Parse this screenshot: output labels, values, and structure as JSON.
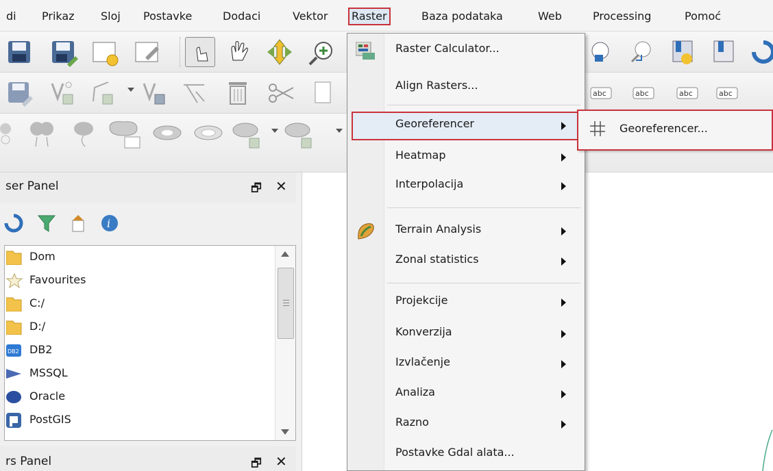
{
  "menubar": {
    "items": [
      "di",
      "Prikaz",
      "Sloj",
      "Postavke",
      "Dodaci",
      "Vektor",
      "Raster",
      "Baza podataka",
      "Web",
      "Processing",
      "Pomoć"
    ]
  },
  "toolbars": {
    "row1_icons": [
      "save-project-icon",
      "save-as-icon",
      "new-print-layout-icon",
      "layout-manager-icon",
      "touch-zoom-icon",
      "pan-map-icon",
      "pan-to-selection-icon",
      "zoom-in-icon"
    ],
    "row2_icons": [
      "save-edits-icon",
      "add-point-icon",
      "add-line-icon",
      "move-feature-icon",
      "node-tool-icon",
      "delete-selected-icon",
      "cut-features-icon",
      "copy-features-icon"
    ],
    "row3_icons": [
      "simplify-feature-icon",
      "add-ring-icon",
      "add-part-icon",
      "fill-ring-icon",
      "delete-ring-icon",
      "delete-part-icon",
      "reshape-icon",
      "offset-curve-icon"
    ],
    "right_icons": [
      "identify-icon",
      "zoom-to-layer-icon",
      "show-bookmarks-icon",
      "new-bookmark-icon",
      "refresh-icon"
    ],
    "label_icons": [
      "label-abc-icon",
      "label-abc-icon",
      "label-abc-icon",
      "label-abc-icon"
    ]
  },
  "browser_panel": {
    "title": "ser Panel",
    "float_glyph": "🗗",
    "close_glyph": "✕",
    "toolbar_icons": [
      "refresh-icon",
      "filter-icon",
      "collapse-all-icon",
      "info-icon"
    ],
    "items": [
      {
        "label": "Dom",
        "icon": "folder-icon"
      },
      {
        "label": "Favourites",
        "icon": "star-icon"
      },
      {
        "label": "C:/",
        "icon": "folder-icon"
      },
      {
        "label": "D:/",
        "icon": "folder-icon"
      },
      {
        "label": "DB2",
        "icon": "db2-icon"
      },
      {
        "label": "MSSQL",
        "icon": "mssql-icon"
      },
      {
        "label": "Oracle",
        "icon": "oracle-icon"
      },
      {
        "label": "PostGIS",
        "icon": "postgis-icon"
      }
    ]
  },
  "layers_panel": {
    "title": "rs Panel",
    "float_glyph": "🗗",
    "close_glyph": "✕"
  },
  "raster_menu": {
    "items": [
      {
        "label": "Raster Calculator...",
        "icon": "raster-calculator-icon",
        "submenu": false
      },
      {
        "label": "Align Rasters...",
        "icon": "",
        "submenu": false
      },
      {
        "label": "Georeferencer",
        "icon": "",
        "submenu": true,
        "highlighted": true
      },
      {
        "label": "Heatmap",
        "icon": "",
        "submenu": true
      },
      {
        "label": "Interpolacija",
        "icon": "",
        "submenu": true
      },
      {
        "label": "Terrain Analysis",
        "icon": "terrain-analysis-icon",
        "submenu": true
      },
      {
        "label": "Zonal statistics",
        "icon": "",
        "submenu": true
      },
      {
        "label": "Projekcije",
        "icon": "",
        "submenu": true
      },
      {
        "label": "Konverzija",
        "icon": "",
        "submenu": true
      },
      {
        "label": "Izvlačenje",
        "icon": "",
        "submenu": true
      },
      {
        "label": "Analiza",
        "icon": "",
        "submenu": true
      },
      {
        "label": "Razno",
        "icon": "",
        "submenu": true
      },
      {
        "label": "Postavke Gdal alata...",
        "icon": "",
        "submenu": false
      }
    ]
  },
  "sub_menu": {
    "item": {
      "label": "Georeferencer...",
      "icon": "georeferencer-grid-icon"
    }
  },
  "colors": {
    "highlight_border": "#c8323c",
    "highlight_fill": "#e4ecf5"
  }
}
